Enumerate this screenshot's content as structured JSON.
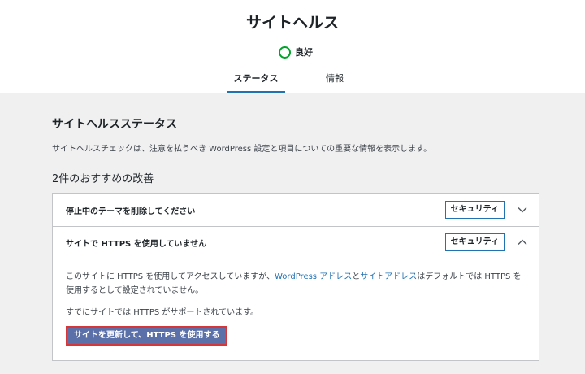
{
  "header": {
    "title": "サイトヘルス",
    "status_label": "良好",
    "status_color": "#00a32a"
  },
  "tabs": [
    {
      "label": "ステータス",
      "active": true
    },
    {
      "label": "情報",
      "active": false
    }
  ],
  "main": {
    "section_title": "サイトヘルスステータス",
    "section_desc": "サイトヘルスチェックは、注意を払うべき WordPress 設定と項目についての重要な情報を表示します。",
    "improvements_title": "2件のおすすめの改善",
    "items": [
      {
        "title": "停止中のテーマを削除してください",
        "badge": "セキュリティ",
        "expanded": false,
        "chevron_icon": "chevron-down-icon"
      },
      {
        "title": "サイトで HTTPS を使用していません",
        "badge": "セキュリティ",
        "expanded": true,
        "chevron_icon": "chevron-up-icon",
        "body": {
          "text_before": "このサイトに HTTPS を使用してアクセスしていますが、",
          "link1": "WordPress アドレス",
          "text_mid": "と",
          "link2": "サイトアドレス",
          "text_after": "はデフォルトでは HTTPS を使用するとして設定されていません。",
          "text2": "すでにサイトでは HTTPS がサポートされています。",
          "button_label": "サイトを更新して、HTTPS を使用する"
        }
      }
    ]
  },
  "colors": {
    "accent": "#2271b1",
    "button_bg": "#5b6fa8",
    "button_highlight": "#d63638"
  }
}
